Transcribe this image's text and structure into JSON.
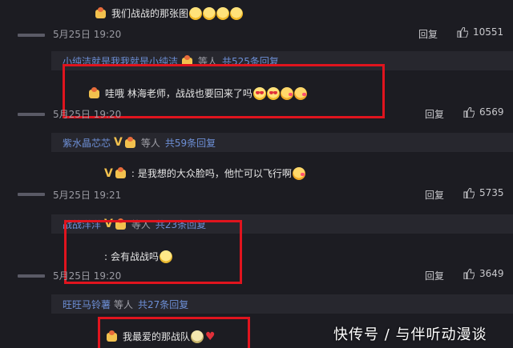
{
  "comments": [
    {
      "text": "我们战战的那张图",
      "date": "5月25日 19:20",
      "reply": "回复",
      "likes": "10551",
      "emojis": [
        "laugh",
        "laugh",
        "laugh",
        "laugh"
      ]
    },
    {
      "text": "哇哦 林海老师，战战也要回来了吗",
      "date": "5月25日 19:20",
      "reply": "回复",
      "likes": "6569",
      "emojis": [
        "love",
        "love",
        "kiss",
        "kiss"
      ]
    },
    {
      "text": "是我想的大众脸吗，他忙可以飞行啊",
      "date": "5月25日 19:21",
      "reply": "回复",
      "likes": "5735",
      "emojis": [
        "kiss"
      ]
    },
    {
      "text": "会有战战吗",
      "date": "5月25日 19:20",
      "reply": "回复",
      "likes": "3649",
      "emojis": [
        "scared"
      ]
    },
    {
      "text": "我最爱的那战队",
      "emojis": [
        "cry",
        "heart"
      ]
    }
  ],
  "threads": [
    {
      "name": "小纯洁就是我我就是小纯洁",
      "suffix": "等人",
      "count": "共525条回复"
    },
    {
      "name": "紫水晶芯芯",
      "suffix": "等人",
      "count": "共59条回复"
    },
    {
      "name": "战战洋洋",
      "suffix": "等人",
      "count": "共23条回复"
    },
    {
      "name": "旺旺马铃薯",
      "suffix": "等人",
      "count": "共27条回复"
    }
  ],
  "watermark": "快传号 / 与伴听动漫谈",
  "colors": {
    "highlight": "#e0141e",
    "link": "#6d8fd6",
    "background": "#1c1c22"
  }
}
